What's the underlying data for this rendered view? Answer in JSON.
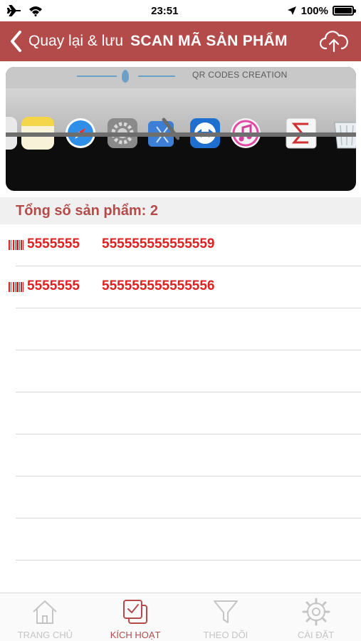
{
  "status_bar": {
    "time": "23:51",
    "battery": "100%",
    "icons": [
      "airplane-icon",
      "wifi-icon",
      "location-icon",
      "battery-icon"
    ]
  },
  "nav": {
    "back_label": "Quay lại & lưu",
    "title": "SCAN MÃ SẢN PHẨM",
    "upload_icon": "cloud-upload-icon"
  },
  "camera": {
    "overlay_text": "QR CODES CREATION"
  },
  "summary": {
    "count_label": "Tổng số sản phẩm: 2"
  },
  "products": [
    {
      "code": "5555555",
      "serial": "555555555555559"
    },
    {
      "code": "5555555",
      "serial": "555555555555556"
    }
  ],
  "tabs": [
    {
      "label": "TRANG CHỦ",
      "icon": "home-icon",
      "active": false
    },
    {
      "label": "KÍCH HOẠT",
      "icon": "activate-icon",
      "active": true
    },
    {
      "label": "THEO DÕI",
      "icon": "filter-icon",
      "active": false
    },
    {
      "label": "CÀI ĐẶT",
      "icon": "gear-icon",
      "active": false
    }
  ],
  "colors": {
    "brand": "#b34b4b",
    "code_text": "#e02020",
    "tab_inactive": "#c5c5c5"
  }
}
